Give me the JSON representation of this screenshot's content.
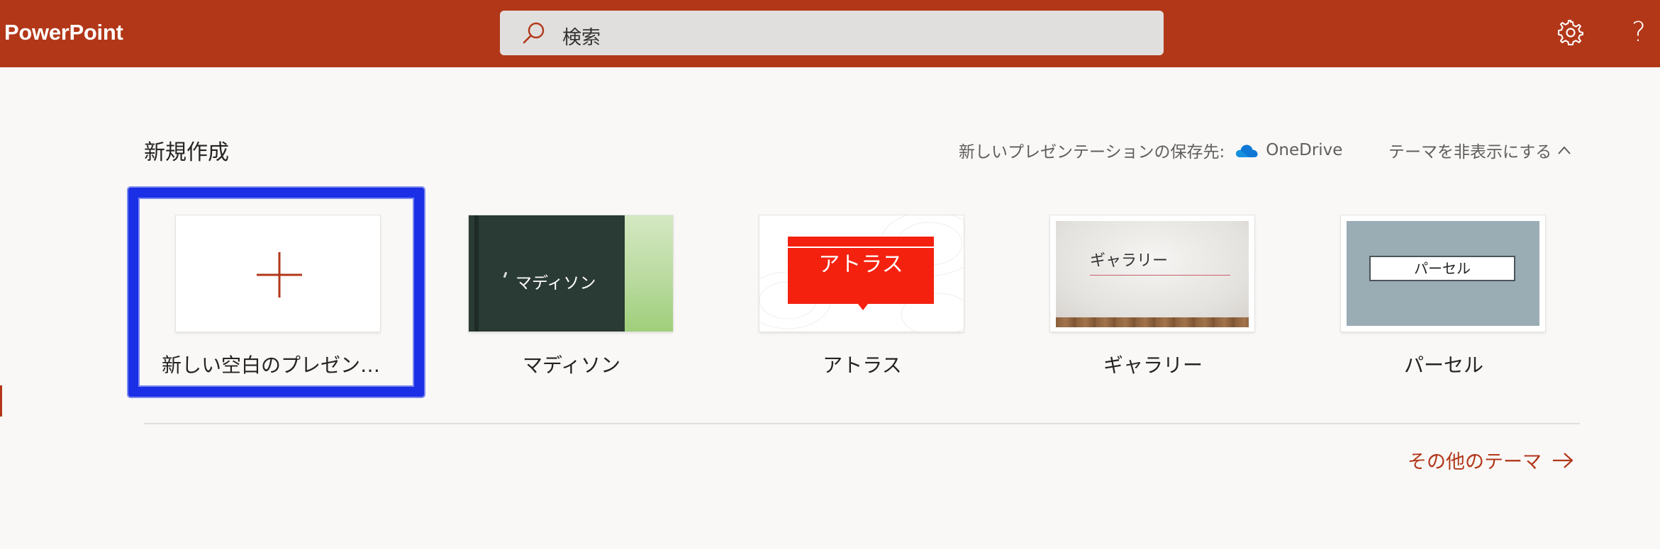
{
  "header": {
    "app_name": "PowerPoint",
    "search_placeholder": "検索",
    "settings_icon": "gear-icon",
    "help_label": "?"
  },
  "new_section": {
    "title": "新規作成",
    "save_location_label": "新しいプレゼンテーションの保存先:",
    "save_location_service": "OneDrive",
    "hide_themes_label": "テーマを非表示にする",
    "more_themes_label": "その他のテーマ"
  },
  "templates": [
    {
      "label": "新しい空白のプレゼンテ...",
      "thumb_text": ""
    },
    {
      "label": "マディソン",
      "thumb_text": "マディソン"
    },
    {
      "label": "アトラス",
      "thumb_text": "アトラス"
    },
    {
      "label": "ギャラリー",
      "thumb_text": "ギャラリー"
    },
    {
      "label": "パーセル",
      "thumb_text": "パーセル"
    }
  ],
  "colors": {
    "brand": "#b23718",
    "highlight": "#1a2fe6",
    "background": "#f9f8f7"
  }
}
